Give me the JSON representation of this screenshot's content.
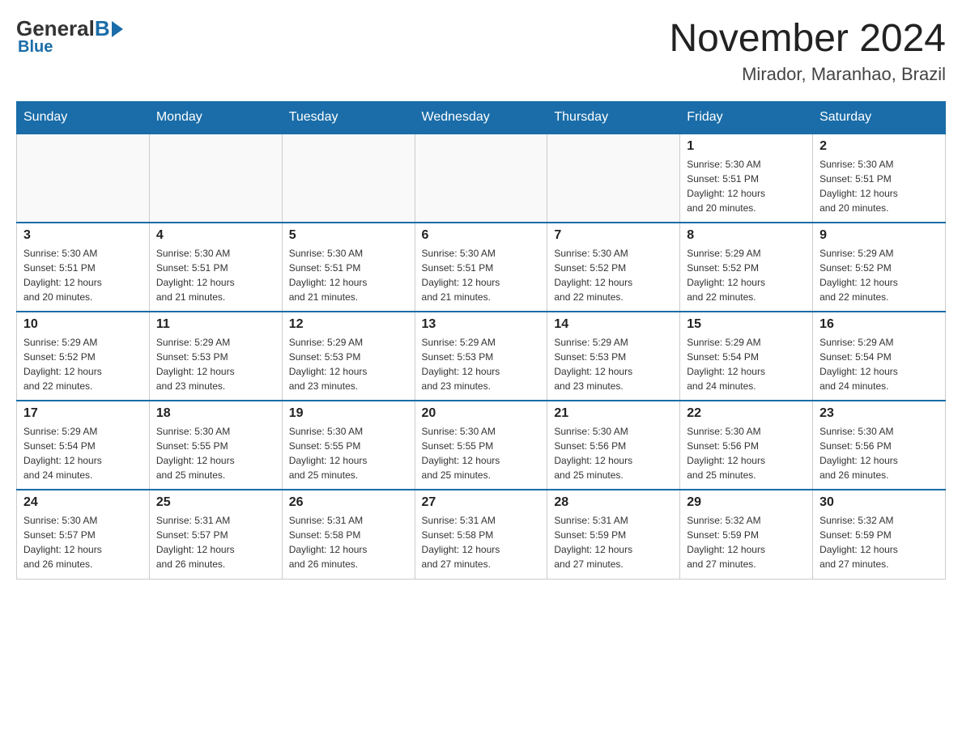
{
  "logo": {
    "general": "General",
    "blue": "Blue",
    "subtitle": "Blue"
  },
  "header": {
    "month_year": "November 2024",
    "location": "Mirador, Maranhao, Brazil"
  },
  "weekdays": [
    "Sunday",
    "Monday",
    "Tuesday",
    "Wednesday",
    "Thursday",
    "Friday",
    "Saturday"
  ],
  "weeks": [
    {
      "days": [
        {
          "date": "",
          "info": ""
        },
        {
          "date": "",
          "info": ""
        },
        {
          "date": "",
          "info": ""
        },
        {
          "date": "",
          "info": ""
        },
        {
          "date": "",
          "info": ""
        },
        {
          "date": "1",
          "info": "Sunrise: 5:30 AM\nSunset: 5:51 PM\nDaylight: 12 hours\nand 20 minutes."
        },
        {
          "date": "2",
          "info": "Sunrise: 5:30 AM\nSunset: 5:51 PM\nDaylight: 12 hours\nand 20 minutes."
        }
      ]
    },
    {
      "days": [
        {
          "date": "3",
          "info": "Sunrise: 5:30 AM\nSunset: 5:51 PM\nDaylight: 12 hours\nand 20 minutes."
        },
        {
          "date": "4",
          "info": "Sunrise: 5:30 AM\nSunset: 5:51 PM\nDaylight: 12 hours\nand 21 minutes."
        },
        {
          "date": "5",
          "info": "Sunrise: 5:30 AM\nSunset: 5:51 PM\nDaylight: 12 hours\nand 21 minutes."
        },
        {
          "date": "6",
          "info": "Sunrise: 5:30 AM\nSunset: 5:51 PM\nDaylight: 12 hours\nand 21 minutes."
        },
        {
          "date": "7",
          "info": "Sunrise: 5:30 AM\nSunset: 5:52 PM\nDaylight: 12 hours\nand 22 minutes."
        },
        {
          "date": "8",
          "info": "Sunrise: 5:29 AM\nSunset: 5:52 PM\nDaylight: 12 hours\nand 22 minutes."
        },
        {
          "date": "9",
          "info": "Sunrise: 5:29 AM\nSunset: 5:52 PM\nDaylight: 12 hours\nand 22 minutes."
        }
      ]
    },
    {
      "days": [
        {
          "date": "10",
          "info": "Sunrise: 5:29 AM\nSunset: 5:52 PM\nDaylight: 12 hours\nand 22 minutes."
        },
        {
          "date": "11",
          "info": "Sunrise: 5:29 AM\nSunset: 5:53 PM\nDaylight: 12 hours\nand 23 minutes."
        },
        {
          "date": "12",
          "info": "Sunrise: 5:29 AM\nSunset: 5:53 PM\nDaylight: 12 hours\nand 23 minutes."
        },
        {
          "date": "13",
          "info": "Sunrise: 5:29 AM\nSunset: 5:53 PM\nDaylight: 12 hours\nand 23 minutes."
        },
        {
          "date": "14",
          "info": "Sunrise: 5:29 AM\nSunset: 5:53 PM\nDaylight: 12 hours\nand 23 minutes."
        },
        {
          "date": "15",
          "info": "Sunrise: 5:29 AM\nSunset: 5:54 PM\nDaylight: 12 hours\nand 24 minutes."
        },
        {
          "date": "16",
          "info": "Sunrise: 5:29 AM\nSunset: 5:54 PM\nDaylight: 12 hours\nand 24 minutes."
        }
      ]
    },
    {
      "days": [
        {
          "date": "17",
          "info": "Sunrise: 5:29 AM\nSunset: 5:54 PM\nDaylight: 12 hours\nand 24 minutes."
        },
        {
          "date": "18",
          "info": "Sunrise: 5:30 AM\nSunset: 5:55 PM\nDaylight: 12 hours\nand 25 minutes."
        },
        {
          "date": "19",
          "info": "Sunrise: 5:30 AM\nSunset: 5:55 PM\nDaylight: 12 hours\nand 25 minutes."
        },
        {
          "date": "20",
          "info": "Sunrise: 5:30 AM\nSunset: 5:55 PM\nDaylight: 12 hours\nand 25 minutes."
        },
        {
          "date": "21",
          "info": "Sunrise: 5:30 AM\nSunset: 5:56 PM\nDaylight: 12 hours\nand 25 minutes."
        },
        {
          "date": "22",
          "info": "Sunrise: 5:30 AM\nSunset: 5:56 PM\nDaylight: 12 hours\nand 25 minutes."
        },
        {
          "date": "23",
          "info": "Sunrise: 5:30 AM\nSunset: 5:56 PM\nDaylight: 12 hours\nand 26 minutes."
        }
      ]
    },
    {
      "days": [
        {
          "date": "24",
          "info": "Sunrise: 5:30 AM\nSunset: 5:57 PM\nDaylight: 12 hours\nand 26 minutes."
        },
        {
          "date": "25",
          "info": "Sunrise: 5:31 AM\nSunset: 5:57 PM\nDaylight: 12 hours\nand 26 minutes."
        },
        {
          "date": "26",
          "info": "Sunrise: 5:31 AM\nSunset: 5:58 PM\nDaylight: 12 hours\nand 26 minutes."
        },
        {
          "date": "27",
          "info": "Sunrise: 5:31 AM\nSunset: 5:58 PM\nDaylight: 12 hours\nand 27 minutes."
        },
        {
          "date": "28",
          "info": "Sunrise: 5:31 AM\nSunset: 5:59 PM\nDaylight: 12 hours\nand 27 minutes."
        },
        {
          "date": "29",
          "info": "Sunrise: 5:32 AM\nSunset: 5:59 PM\nDaylight: 12 hours\nand 27 minutes."
        },
        {
          "date": "30",
          "info": "Sunrise: 5:32 AM\nSunset: 5:59 PM\nDaylight: 12 hours\nand 27 minutes."
        }
      ]
    }
  ]
}
